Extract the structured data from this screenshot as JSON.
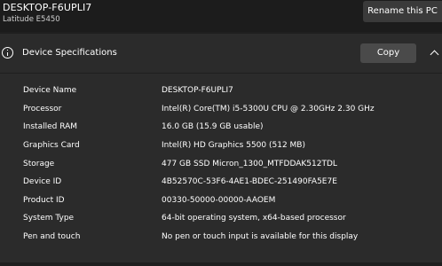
{
  "pc": {
    "name": "DESKTOP-F6UPLI7",
    "model": "Latitude E5450",
    "rename_label": "Rename this PC"
  },
  "device_specs": {
    "title": "Device Specifications",
    "copy_label": "Copy",
    "icon": "info-icon",
    "rows": [
      {
        "label": "Device Name",
        "value": "DESKTOP-F6UPLI7"
      },
      {
        "label": "Processor",
        "value": "Intel(R) Core(TM) i5-5300U CPU @ 2.30GHz   2.30 GHz"
      },
      {
        "label": "Installed RAM",
        "value": "16.0 GB (15.9 GB usable)"
      },
      {
        "label": "Graphics Card",
        "value": "Intel(R) HD Graphics 5500 (512 MB)"
      },
      {
        "label": "Storage",
        "value": "477 GB SSD Micron_1300_MTFDDAK512TDL"
      },
      {
        "label": "Device ID",
        "value": "4B52570C-53F6-4AE1-BDEC-251490FA5E7E"
      },
      {
        "label": "Product ID",
        "value": "00330-50000-00000-AAOEM"
      },
      {
        "label": "System Type",
        "value": "64-bit operating system, x64-based processor"
      },
      {
        "label": "Pen and touch",
        "value": "No pen or touch input is available for this display"
      }
    ]
  },
  "colors": {
    "background": "#1f1f1f",
    "card": "#2b2b2b",
    "button": "#4a4a4a",
    "rename_button": "#3a3a3a",
    "text": "#ffffff"
  }
}
